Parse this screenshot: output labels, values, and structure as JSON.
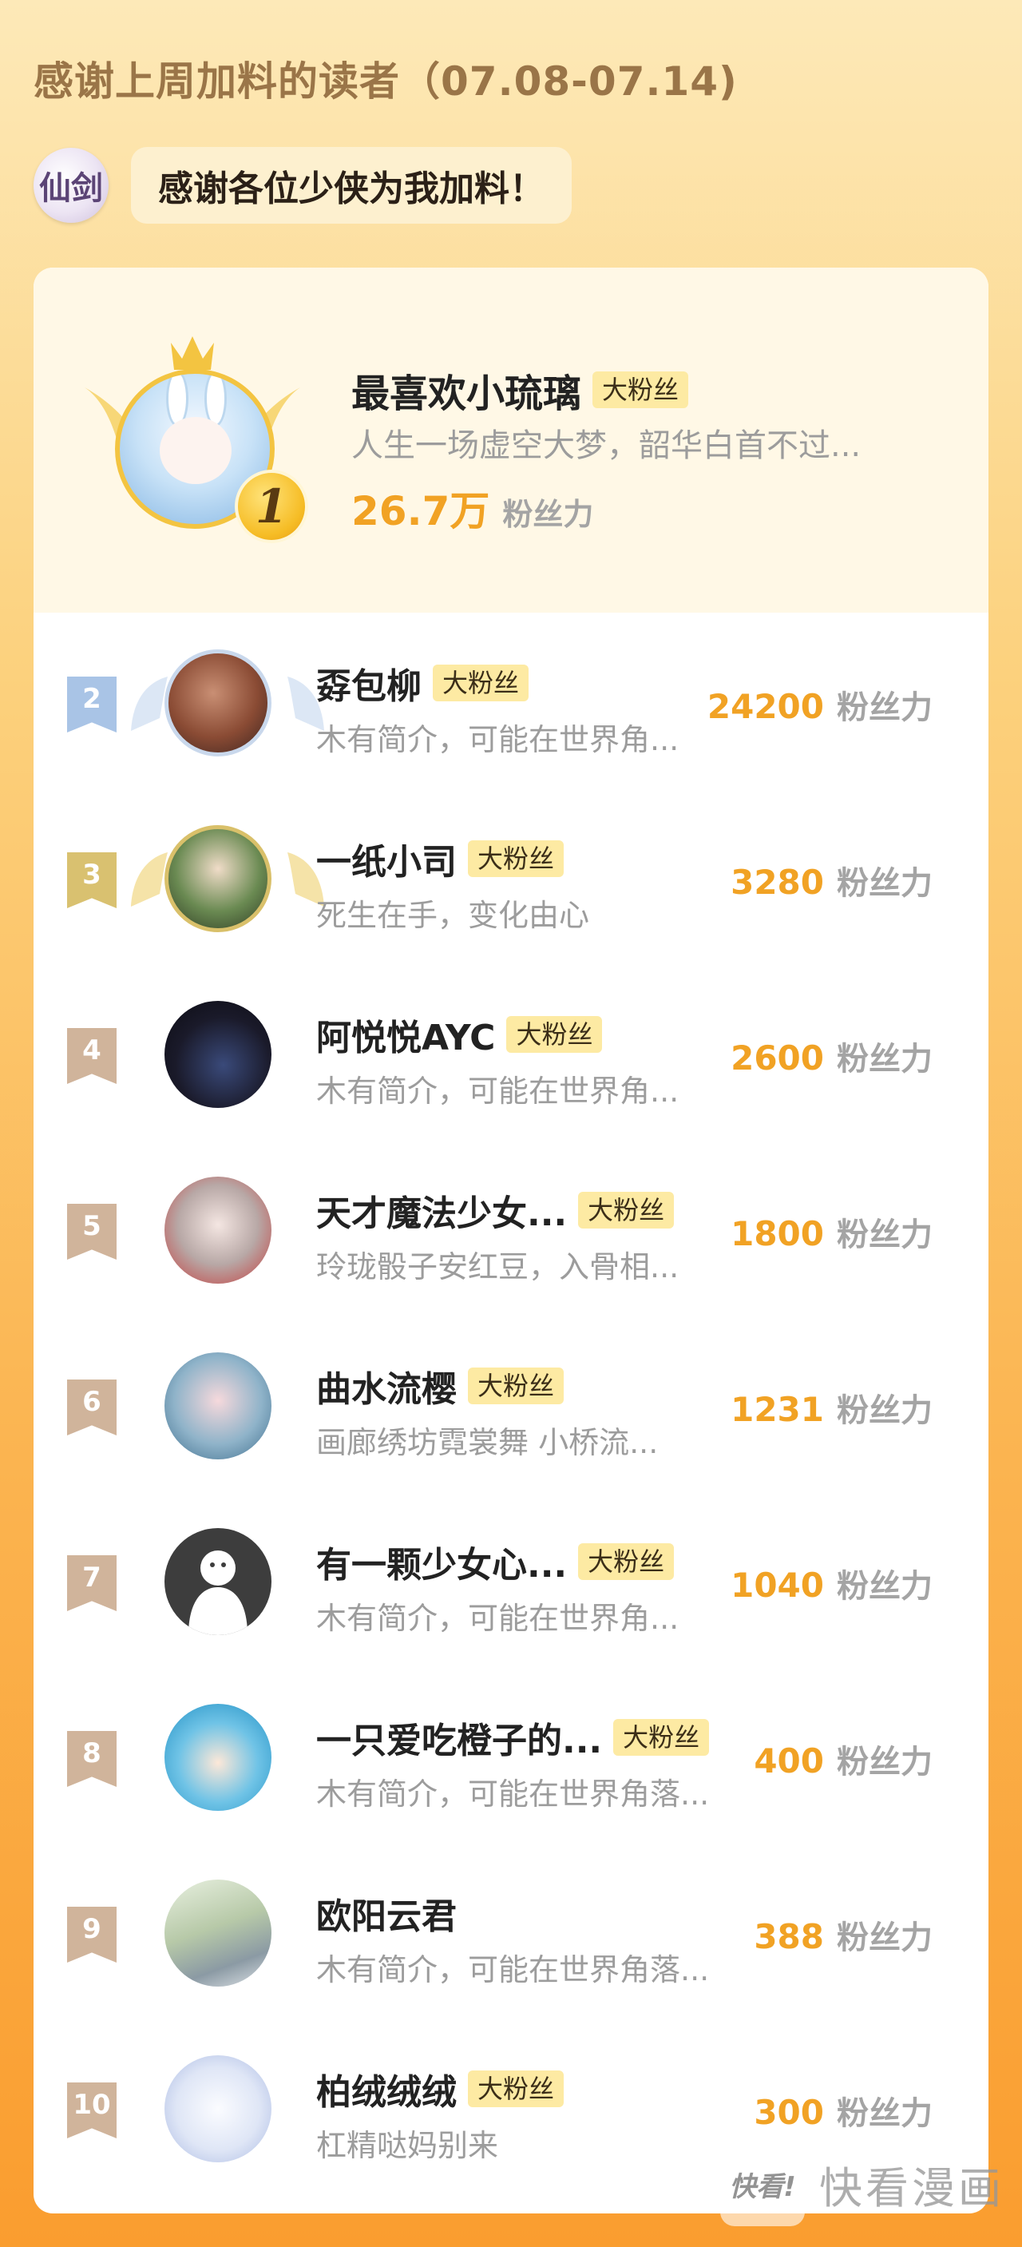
{
  "header": {
    "title": "感谢上周加料的读者（07.08-07.14)"
  },
  "author": {
    "avatar_text": "仙剑",
    "message": "感谢各位少侠为我加料！"
  },
  "top1": {
    "rank": "1",
    "name": "最喜欢小琉璃",
    "badge": "大粉丝",
    "bio": "人生一场虚空大梦，韶华白首不过...",
    "score": "26.7万",
    "unit": "粉丝力"
  },
  "rows": [
    {
      "rank": "2",
      "name": "孬包柳",
      "badge": "大粉丝",
      "bio": "木有简介，可能在世界角...",
      "score": "24200",
      "unit": "粉丝力",
      "ribbon_color": "#a9c4e6"
    },
    {
      "rank": "3",
      "name": "一纸小司",
      "badge": "大粉丝",
      "bio": "死生在手，变化由心",
      "score": "3280",
      "unit": "粉丝力",
      "ribbon_color": "#d9c170"
    },
    {
      "rank": "4",
      "name": "阿悦悦AYC",
      "badge": "大粉丝",
      "bio": "木有简介，可能在世界角...",
      "score": "2600",
      "unit": "粉丝力",
      "ribbon_color": "#d0b49b"
    },
    {
      "rank": "5",
      "name": "天才魔法少女...",
      "badge": "大粉丝",
      "bio": "玲珑骰子安红豆，入骨相...",
      "score": "1800",
      "unit": "粉丝力",
      "ribbon_color": "#d0b49b"
    },
    {
      "rank": "6",
      "name": "曲水流樱",
      "badge": "大粉丝",
      "bio": "画廊绣坊霓裳舞 小桥流...",
      "score": "1231",
      "unit": "粉丝力",
      "ribbon_color": "#d0b49b"
    },
    {
      "rank": "7",
      "name": "有一颗少女心...",
      "badge": "大粉丝",
      "bio": "木有简介，可能在世界角...",
      "score": "1040",
      "unit": "粉丝力",
      "ribbon_color": "#d0b49b"
    },
    {
      "rank": "8",
      "name": "一只爱吃橙子的...",
      "badge": "大粉丝",
      "bio": "木有简介，可能在世界角落...",
      "score": "400",
      "unit": "粉丝力",
      "ribbon_color": "#d0b49b"
    },
    {
      "rank": "9",
      "name": "欧阳云君",
      "badge": "",
      "bio": "木有简介，可能在世界角落...",
      "score": "388",
      "unit": "粉丝力",
      "ribbon_color": "#d0b49b"
    },
    {
      "rank": "10",
      "name": "柏绒绒绒",
      "badge": "大粉丝",
      "bio": "杠精哒妈别来",
      "score": "300",
      "unit": "粉丝力",
      "ribbon_color": "#d0b49b"
    }
  ],
  "watermark": {
    "logo": "快看!",
    "text": "快看漫画"
  }
}
